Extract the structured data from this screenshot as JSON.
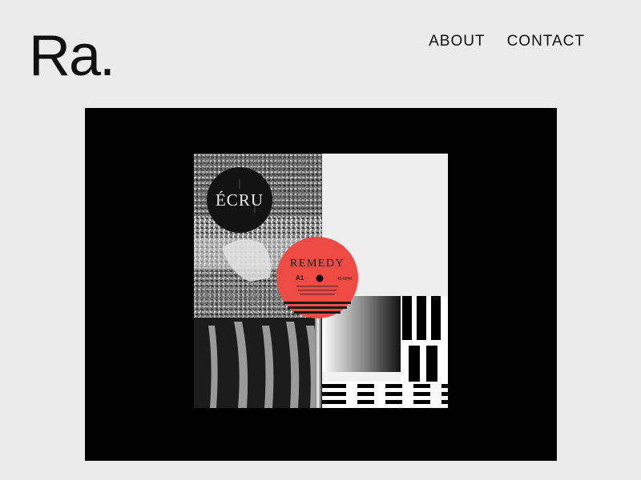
{
  "brand": {
    "logo": "Ra."
  },
  "nav": {
    "items": [
      {
        "label": "ABOUT"
      },
      {
        "label": "CONTACT"
      }
    ]
  },
  "hero": {
    "cover": {
      "badge_text": "ÉCRU",
      "record_title": "REMEDY",
      "side": "A1",
      "speed": "45 RPM",
      "label_colors": {
        "record": "#ee4b45",
        "background": "#000000"
      }
    }
  }
}
